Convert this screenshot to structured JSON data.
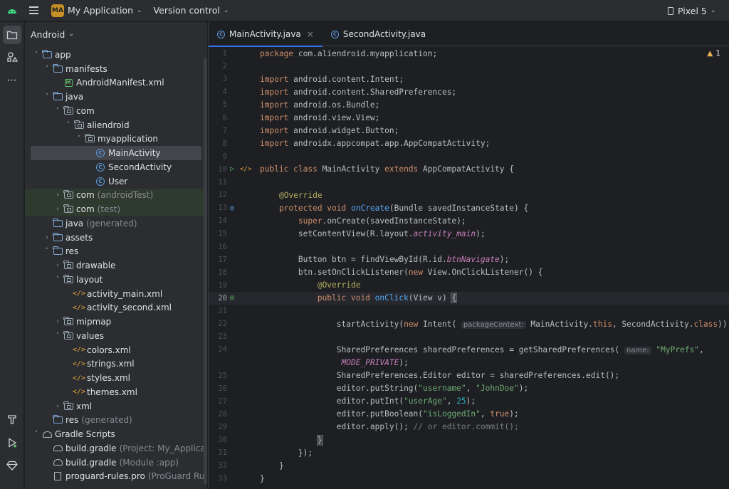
{
  "titlebar": {
    "project_badge": "MA",
    "project_name": "My Application",
    "vcs_label": "Version control",
    "device": "Pixel 5"
  },
  "project_panel": {
    "view_label": "Android",
    "tree": [
      {
        "label": "app",
        "icon": "module-folder-icon",
        "depth": 0,
        "arrow": "down"
      },
      {
        "label": "manifests",
        "icon": "folder-icon",
        "depth": 1,
        "arrow": "down"
      },
      {
        "label": "AndroidManifest.xml",
        "icon": "manifest-icon",
        "depth": 2,
        "arrow": ""
      },
      {
        "label": "java",
        "icon": "folder-icon",
        "depth": 1,
        "arrow": "down"
      },
      {
        "label": "com",
        "icon": "package-icon",
        "depth": 2,
        "arrow": "down"
      },
      {
        "label": "aliendroid",
        "icon": "package-icon",
        "depth": 3,
        "arrow": "down"
      },
      {
        "label": "myapplication",
        "icon": "package-icon",
        "depth": 4,
        "arrow": "down"
      },
      {
        "label": "MainActivity",
        "icon": "class-icon",
        "depth": 5,
        "arrow": "",
        "selected": true
      },
      {
        "label": "SecondActivity",
        "icon": "class-icon",
        "depth": 5,
        "arrow": ""
      },
      {
        "label": "User",
        "icon": "class-icon",
        "depth": 5,
        "arrow": ""
      },
      {
        "label": "com",
        "sub": "(androidTest)",
        "icon": "package-icon",
        "depth": 2,
        "arrow": "right",
        "tinted": true
      },
      {
        "label": "com",
        "sub": "(test)",
        "icon": "package-icon",
        "depth": 2,
        "arrow": "right",
        "tinted": true
      },
      {
        "label": "java",
        "sub": "(generated)",
        "icon": "folder-icon",
        "depth": 1,
        "arrow": ""
      },
      {
        "label": "assets",
        "icon": "folder-icon",
        "depth": 1,
        "arrow": "right"
      },
      {
        "label": "res",
        "icon": "folder-icon",
        "depth": 1,
        "arrow": "down"
      },
      {
        "label": "drawable",
        "icon": "package-icon",
        "depth": 2,
        "arrow": "right"
      },
      {
        "label": "layout",
        "icon": "package-icon",
        "depth": 2,
        "arrow": "down"
      },
      {
        "label": "activity_main.xml",
        "icon": "xml-icon",
        "depth": 3,
        "arrow": ""
      },
      {
        "label": "activity_second.xml",
        "icon": "xml-icon",
        "depth": 3,
        "arrow": ""
      },
      {
        "label": "mipmap",
        "icon": "package-icon",
        "depth": 2,
        "arrow": "right"
      },
      {
        "label": "values",
        "icon": "package-icon",
        "depth": 2,
        "arrow": "down"
      },
      {
        "label": "colors.xml",
        "icon": "xml-icon",
        "depth": 3,
        "arrow": ""
      },
      {
        "label": "strings.xml",
        "icon": "xml-icon",
        "depth": 3,
        "arrow": ""
      },
      {
        "label": "styles.xml",
        "icon": "xml-icon",
        "depth": 3,
        "arrow": ""
      },
      {
        "label": "themes.xml",
        "icon": "xml-icon",
        "depth": 3,
        "arrow": ""
      },
      {
        "label": "xml",
        "icon": "package-icon",
        "depth": 2,
        "arrow": "right"
      },
      {
        "label": "res",
        "sub": "(generated)",
        "icon": "folder-icon",
        "depth": 1,
        "arrow": ""
      },
      {
        "label": "Gradle Scripts",
        "icon": "gradle-icon",
        "depth": 0,
        "arrow": "down"
      },
      {
        "label": "build.gradle",
        "sub": "(Project: My_Application)",
        "icon": "gradle-icon",
        "depth": 1,
        "arrow": ""
      },
      {
        "label": "build.gradle",
        "sub": "(Module :app)",
        "icon": "gradle-icon",
        "depth": 1,
        "arrow": ""
      },
      {
        "label": "proguard-rules.pro",
        "sub": "(ProGuard Rules fo",
        "icon": "file-icon",
        "depth": 1,
        "arrow": ""
      }
    ]
  },
  "editor": {
    "tabs": [
      {
        "label": "MainActivity.java",
        "active": true,
        "close": "×"
      },
      {
        "label": "SecondActivity.java",
        "active": false
      }
    ],
    "warnings": {
      "icon": "warning-icon",
      "count": "1"
    },
    "lines": [
      {
        "n": "1",
        "html": "<span class=\"kw\">package</span> com.aliendroid.myapplication;"
      },
      {
        "n": "2",
        "html": ""
      },
      {
        "n": "3",
        "html": "<span class=\"kw\">import</span> android.content.Intent;"
      },
      {
        "n": "4",
        "html": "<span class=\"kw\">import</span> android.content.SharedPreferences;"
      },
      {
        "n": "5",
        "html": "<span class=\"kw\">import</span> android.os.Bundle;"
      },
      {
        "n": "6",
        "html": "<span class=\"kw\">import</span> android.view.View;"
      },
      {
        "n": "7",
        "html": "<span class=\"kw\">import</span> android.widget.Button;"
      },
      {
        "n": "8",
        "html": "<span class=\"kw\">import</span> androidx.appcompat.app.AppCompatActivity;"
      },
      {
        "n": "9",
        "html": ""
      },
      {
        "n": "10",
        "html": "<span class=\"kw\">public class</span> MainActivity <span class=\"kw\">extends</span> AppCompatActivity {",
        "gutter": "run"
      },
      {
        "n": "11",
        "html": ""
      },
      {
        "n": "12",
        "html": "    <span class=\"ann\">@Override</span>"
      },
      {
        "n": "13",
        "html": "    <span class=\"kw\">protected void</span> <span class=\"fn\">onCreate</span>(Bundle savedInstanceState) {",
        "gutter": "override"
      },
      {
        "n": "14",
        "html": "        <span class=\"kw\">super</span>.onCreate(savedInstanceState);"
      },
      {
        "n": "15",
        "html": "        setContentView(R.layout.<span class=\"const\">activity_main</span>);"
      },
      {
        "n": "16",
        "html": ""
      },
      {
        "n": "17",
        "html": "        Button btn = findViewById(R.id.<span class=\"const\">btnNavigate</span>);"
      },
      {
        "n": "18",
        "html": "        btn.setOnClickListener(<span class=\"kw\">new</span> View.OnClickListener() {"
      },
      {
        "n": "19",
        "html": "            <span class=\"ann\">@Override</span>"
      },
      {
        "n": "20",
        "html": "            <span class=\"kw\">public void</span> <span class=\"fn\">onClick</span>(View v) <span class=\"brace-hl\">{</span>",
        "gutter": "implement",
        "current": true
      },
      {
        "n": "21",
        "html": ""
      },
      {
        "n": "22",
        "html": "                startActivity(<span class=\"kw\">new</span> Intent( <span class=\"hint\">packageContext:</span> MainActivity.<span class=\"kw\">this</span>, SecondActivity.<span class=\"kw\">class</span>));"
      },
      {
        "n": "23",
        "html": ""
      },
      {
        "n": "24",
        "html": "                SharedPreferences sharedPreferences = getSharedPreferences( <span class=\"hint\">name:</span> <span class=\"str\">\"MyPrefs\"</span>,"
      },
      {
        "n": "",
        "html": "                 <span class=\"const\">MODE_PRIVATE</span>);"
      },
      {
        "n": "25",
        "html": "                SharedPreferences.Editor editor = sharedPreferences.edit();"
      },
      {
        "n": "26",
        "html": "                editor.putString(<span class=\"str\">\"username\"</span>, <span class=\"str\">\"JohnDoe\"</span>);"
      },
      {
        "n": "27",
        "html": "                editor.putInt(<span class=\"str\">\"userAge\"</span>, <span class=\"num\">25</span>);"
      },
      {
        "n": "28",
        "html": "                editor.putBoolean(<span class=\"str\">\"isLoggedIn\"</span>, <span class=\"kw\">true</span>);"
      },
      {
        "n": "29",
        "html": "                editor.apply(); <span class=\"cmt\">// or editor.commit();</span>"
      },
      {
        "n": "30",
        "html": "            <span class=\"brace-hl\">}</span>"
      },
      {
        "n": "31",
        "html": "        });"
      },
      {
        "n": "32",
        "html": "    }"
      },
      {
        "n": "33",
        "html": "}"
      }
    ]
  }
}
